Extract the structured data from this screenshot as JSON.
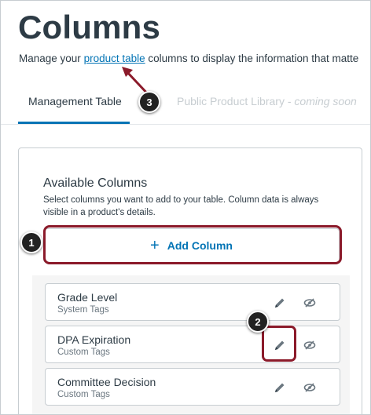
{
  "header": {
    "title": "Columns",
    "intro_before": "Manage your ",
    "intro_link": "product table",
    "intro_after": " columns to display the information that matte"
  },
  "tabs": [
    {
      "label": "Management Table"
    },
    {
      "label": "Public Product Library",
      "suffix": "coming soon"
    }
  ],
  "available_columns": {
    "title": "Available Columns",
    "description": "Select columns you want to add to your table. Column data is always visible in a product's details.",
    "add_button_label": "Add Column",
    "items": [
      {
        "name": "Grade Level",
        "tag": "System Tags"
      },
      {
        "name": "DPA Expiration",
        "tag": "Custom Tags"
      },
      {
        "name": "Committee Decision",
        "tag": "Custom Tags"
      }
    ]
  },
  "callouts": [
    "1",
    "2",
    "3"
  ],
  "icons": {
    "edit": "pencil-icon",
    "hide": "eye-slash-icon",
    "add": "plus-icon"
  },
  "colors": {
    "link": "#0374b5",
    "highlight": "#8b1a2a",
    "text": "#2d3b45"
  }
}
